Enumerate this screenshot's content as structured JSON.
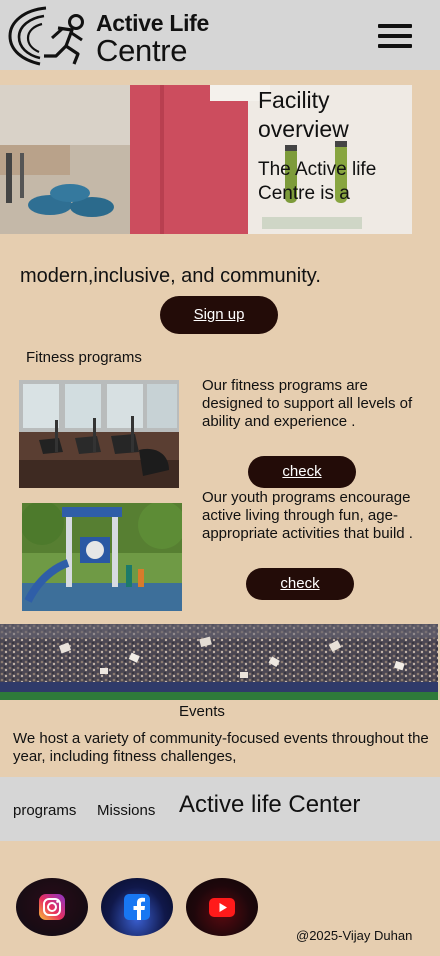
{
  "header": {
    "logo_line1": "Active Life",
    "logo_line2": "Centre"
  },
  "hero": {
    "title": "Facility overview",
    "subtitle": "The Active life Centre is a"
  },
  "intro": {
    "text": "modern,inclusive, and community.",
    "signup_label": "Sign up"
  },
  "fitness": {
    "section_title": "Fitness programs",
    "description": "Our fitness programs are  designed to support all levels of ability and experience .",
    "check_label": "check"
  },
  "youth": {
    "description": "Our youth programs encourage  active living through fun, age-appropriate activities that build .",
    "check_label": "check"
  },
  "events": {
    "title": "Events",
    "text": "We host a variety of community-focused events throughout  the year, including fitness challenges,"
  },
  "footer": {
    "nav_programs": "programs",
    "nav_missions": "Missions",
    "brand": "Active life Center",
    "copyright": "@2025-Vijay Duhan"
  },
  "social": {
    "icons": [
      "instagram-icon",
      "facebook-icon",
      "youtube-icon"
    ]
  },
  "colors": {
    "page_bg": "#e6ceb0",
    "header_bg": "#d6d6d6",
    "button_bg": "#230c08"
  }
}
